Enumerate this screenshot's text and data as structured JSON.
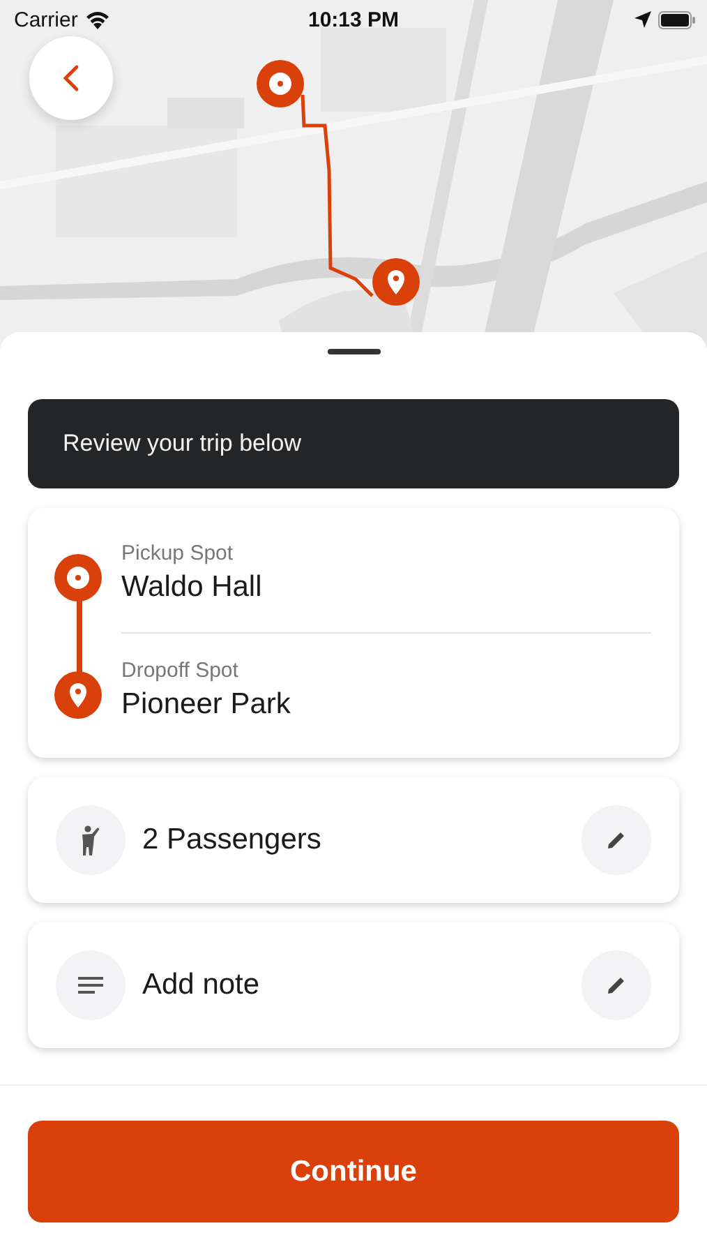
{
  "status_bar": {
    "carrier": "Carrier",
    "time": "10:13 PM"
  },
  "sheet": {
    "banner": "Review your trip below",
    "stops": [
      {
        "kind": "pickup",
        "label": "Pickup Spot",
        "place": "Waldo Hall"
      },
      {
        "kind": "dropoff",
        "label": "Dropoff Spot",
        "place": "Pioneer Park"
      }
    ],
    "options": [
      {
        "kind": "passengers",
        "text": "2 Passengers"
      },
      {
        "kind": "note",
        "text": "Add note"
      }
    ],
    "button": "Continue"
  }
}
